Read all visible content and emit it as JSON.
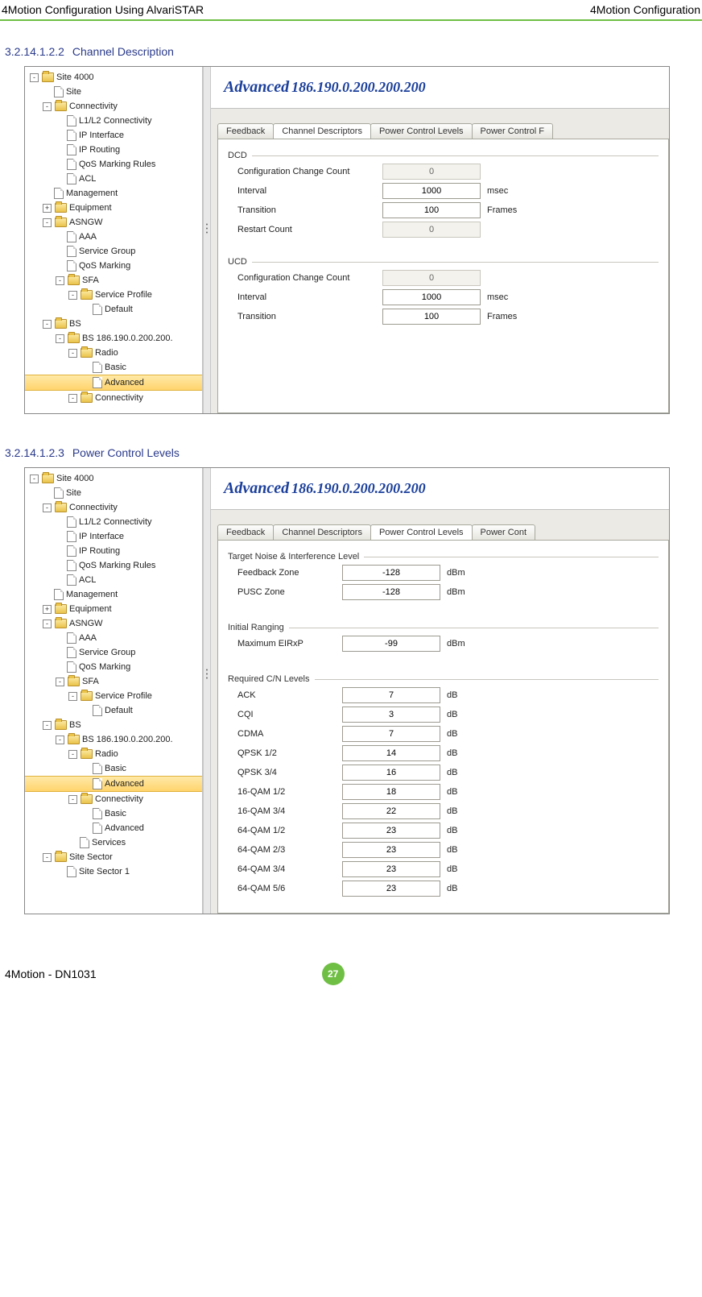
{
  "header": {
    "left": "4Motion Configuration Using AlvariSTAR",
    "right": "4Motion Configuration"
  },
  "section1": {
    "num": "3.2.14.1.2.2",
    "title": "Channel Description"
  },
  "section2": {
    "num": "3.2.14.1.2.3",
    "title": "Power Control Levels"
  },
  "banner": {
    "title": "Advanced",
    "ip": "186.190.0.200.200.200"
  },
  "tabs": {
    "feedback": "Feedback",
    "channel": "Channel Descriptors",
    "power": "Power Control Levels",
    "powerF": "Power Control F",
    "powerCont": "Power Cont"
  },
  "tree1": [
    {
      "d": 0,
      "t": "f",
      "e": "-",
      "l": "Site 4000"
    },
    {
      "d": 1,
      "t": "p",
      "l": "Site"
    },
    {
      "d": 1,
      "t": "f",
      "e": "-",
      "l": "Connectivity"
    },
    {
      "d": 2,
      "t": "p",
      "l": "L1/L2 Connectivity"
    },
    {
      "d": 2,
      "t": "p",
      "l": "IP Interface"
    },
    {
      "d": 2,
      "t": "p",
      "l": "IP Routing"
    },
    {
      "d": 2,
      "t": "p",
      "l": "QoS Marking Rules"
    },
    {
      "d": 2,
      "t": "p",
      "l": "ACL"
    },
    {
      "d": 1,
      "t": "p",
      "l": "Management"
    },
    {
      "d": 1,
      "t": "f",
      "e": "+",
      "l": "Equipment"
    },
    {
      "d": 1,
      "t": "f",
      "e": "-",
      "l": "ASNGW"
    },
    {
      "d": 2,
      "t": "p",
      "l": "AAA"
    },
    {
      "d": 2,
      "t": "p",
      "l": "Service Group"
    },
    {
      "d": 2,
      "t": "p",
      "l": "QoS Marking"
    },
    {
      "d": 2,
      "t": "f",
      "e": "-",
      "l": "SFA"
    },
    {
      "d": 3,
      "t": "f",
      "e": "-",
      "l": "Service Profile"
    },
    {
      "d": 4,
      "t": "p",
      "l": "Default"
    },
    {
      "d": 1,
      "t": "f",
      "e": "-",
      "l": "BS"
    },
    {
      "d": 2,
      "t": "f",
      "e": "-",
      "l": "BS 186.190.0.200.200."
    },
    {
      "d": 3,
      "t": "f",
      "e": "-",
      "l": "Radio"
    },
    {
      "d": 4,
      "t": "p",
      "l": "Basic"
    },
    {
      "d": 4,
      "t": "p",
      "l": "Advanced",
      "sel": true
    },
    {
      "d": 3,
      "t": "f",
      "e": "-",
      "l": "Connectivity"
    }
  ],
  "tree2": [
    {
      "d": 0,
      "t": "f",
      "e": "-",
      "l": "Site 4000"
    },
    {
      "d": 1,
      "t": "p",
      "l": "Site"
    },
    {
      "d": 1,
      "t": "f",
      "e": "-",
      "l": "Connectivity"
    },
    {
      "d": 2,
      "t": "p",
      "l": "L1/L2 Connectivity"
    },
    {
      "d": 2,
      "t": "p",
      "l": "IP Interface"
    },
    {
      "d": 2,
      "t": "p",
      "l": "IP Routing"
    },
    {
      "d": 2,
      "t": "p",
      "l": "QoS Marking Rules"
    },
    {
      "d": 2,
      "t": "p",
      "l": "ACL"
    },
    {
      "d": 1,
      "t": "p",
      "l": "Management"
    },
    {
      "d": 1,
      "t": "f",
      "e": "+",
      "l": "Equipment"
    },
    {
      "d": 1,
      "t": "f",
      "e": "-",
      "l": "ASNGW"
    },
    {
      "d": 2,
      "t": "p",
      "l": "AAA"
    },
    {
      "d": 2,
      "t": "p",
      "l": "Service Group"
    },
    {
      "d": 2,
      "t": "p",
      "l": "QoS Marking"
    },
    {
      "d": 2,
      "t": "f",
      "e": "-",
      "l": "SFA"
    },
    {
      "d": 3,
      "t": "f",
      "e": "-",
      "l": "Service Profile"
    },
    {
      "d": 4,
      "t": "p",
      "l": "Default"
    },
    {
      "d": 1,
      "t": "f",
      "e": "-",
      "l": "BS"
    },
    {
      "d": 2,
      "t": "f",
      "e": "-",
      "l": "BS 186.190.0.200.200."
    },
    {
      "d": 3,
      "t": "f",
      "e": "-",
      "l": "Radio"
    },
    {
      "d": 4,
      "t": "p",
      "l": "Basic"
    },
    {
      "d": 4,
      "t": "p",
      "l": "Advanced",
      "sel": true
    },
    {
      "d": 3,
      "t": "f",
      "e": "-",
      "l": "Connectivity"
    },
    {
      "d": 4,
      "t": "p",
      "l": "Basic"
    },
    {
      "d": 4,
      "t": "p",
      "l": "Advanced"
    },
    {
      "d": 3,
      "t": "p",
      "l": "Services"
    },
    {
      "d": 1,
      "t": "f",
      "e": "-",
      "l": "Site Sector"
    },
    {
      "d": 2,
      "t": "p",
      "l": "Site Sector 1"
    }
  ],
  "form1": {
    "dcd": "DCD",
    "ucd": "UCD",
    "ccc": "Configuration Change Count",
    "interval": "Interval",
    "transition": "Transition",
    "restart": "Restart Count",
    "msec": "msec",
    "frames": "Frames",
    "v_dcd_ccc": "0",
    "v_dcd_int": "1000",
    "v_dcd_tr": "100",
    "v_dcd_rst": "0",
    "v_ucd_ccc": "0",
    "v_ucd_int": "1000",
    "v_ucd_tr": "100"
  },
  "form2": {
    "g1": "Target Noise & Interference Level",
    "g2": "Initial Ranging",
    "g3": "Required C/N Levels",
    "fbz": "Feedback Zone",
    "pusc": "PUSC Zone",
    "eirp": "Maximum EIRxP",
    "dbm": "dBm",
    "db": "dB",
    "v_fbz": "-128",
    "v_pusc": "-128",
    "v_eirp": "-99",
    "cn": [
      {
        "l": "ACK",
        "v": "7"
      },
      {
        "l": "CQI",
        "v": "3"
      },
      {
        "l": "CDMA",
        "v": "7"
      },
      {
        "l": "QPSK 1/2",
        "v": "14"
      },
      {
        "l": "QPSK 3/4",
        "v": "16"
      },
      {
        "l": "16-QAM 1/2",
        "v": "18"
      },
      {
        "l": "16-QAM 3/4",
        "v": "22"
      },
      {
        "l": "64-QAM 1/2",
        "v": "23"
      },
      {
        "l": "64-QAM 2/3",
        "v": "23"
      },
      {
        "l": "64-QAM 3/4",
        "v": "23"
      },
      {
        "l": "64-QAM 5/6",
        "v": "23"
      }
    ]
  },
  "footer": {
    "left": "4Motion - DN1031",
    "page": "27"
  }
}
